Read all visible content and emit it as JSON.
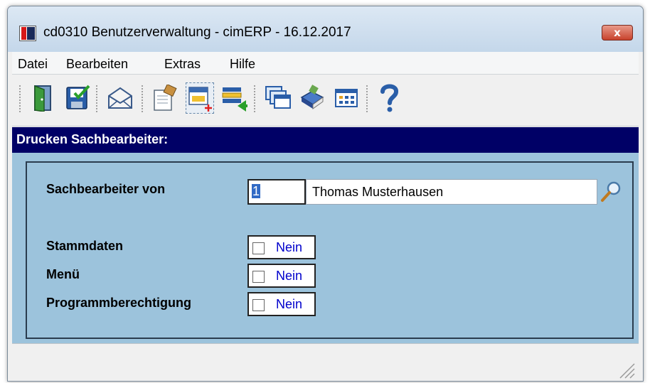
{
  "window": {
    "title": "cd0310 Benutzerverwaltung - cimERP - 16.12.2017",
    "close_label": "x"
  },
  "menu": {
    "items": [
      "Datei",
      "Bearbeiten",
      "Extras",
      "Hilfe"
    ]
  },
  "toolbar": {
    "buttons": [
      {
        "icon": "exit-door-icon"
      },
      {
        "icon": "save-icon"
      },
      {
        "icon": "mail-icon"
      },
      {
        "icon": "edit-document-icon"
      },
      {
        "icon": "new-record-icon"
      },
      {
        "icon": "import-list-icon"
      },
      {
        "icon": "windows-icon"
      },
      {
        "icon": "book-icon"
      },
      {
        "icon": "grid-view-icon"
      },
      {
        "icon": "help-icon"
      }
    ]
  },
  "section": {
    "header": "Drucken Sachbearbeiter:"
  },
  "form": {
    "sachbearbeiter_label": "Sachbearbeiter von",
    "sachbearbeiter_id": "1",
    "sachbearbeiter_name": "Thomas Musterhausen",
    "stammdaten_label": "Stammdaten",
    "stammdaten_value": "Nein",
    "menue_label": "Menü",
    "menue_value": "Nein",
    "programmberechtigung_label": "Programmberechtigung",
    "programmberechtigung_value": "Nein"
  },
  "colors": {
    "header_bg": "#000066",
    "content_bg": "#9cc3dc",
    "checkbox_text": "#0000cc"
  }
}
